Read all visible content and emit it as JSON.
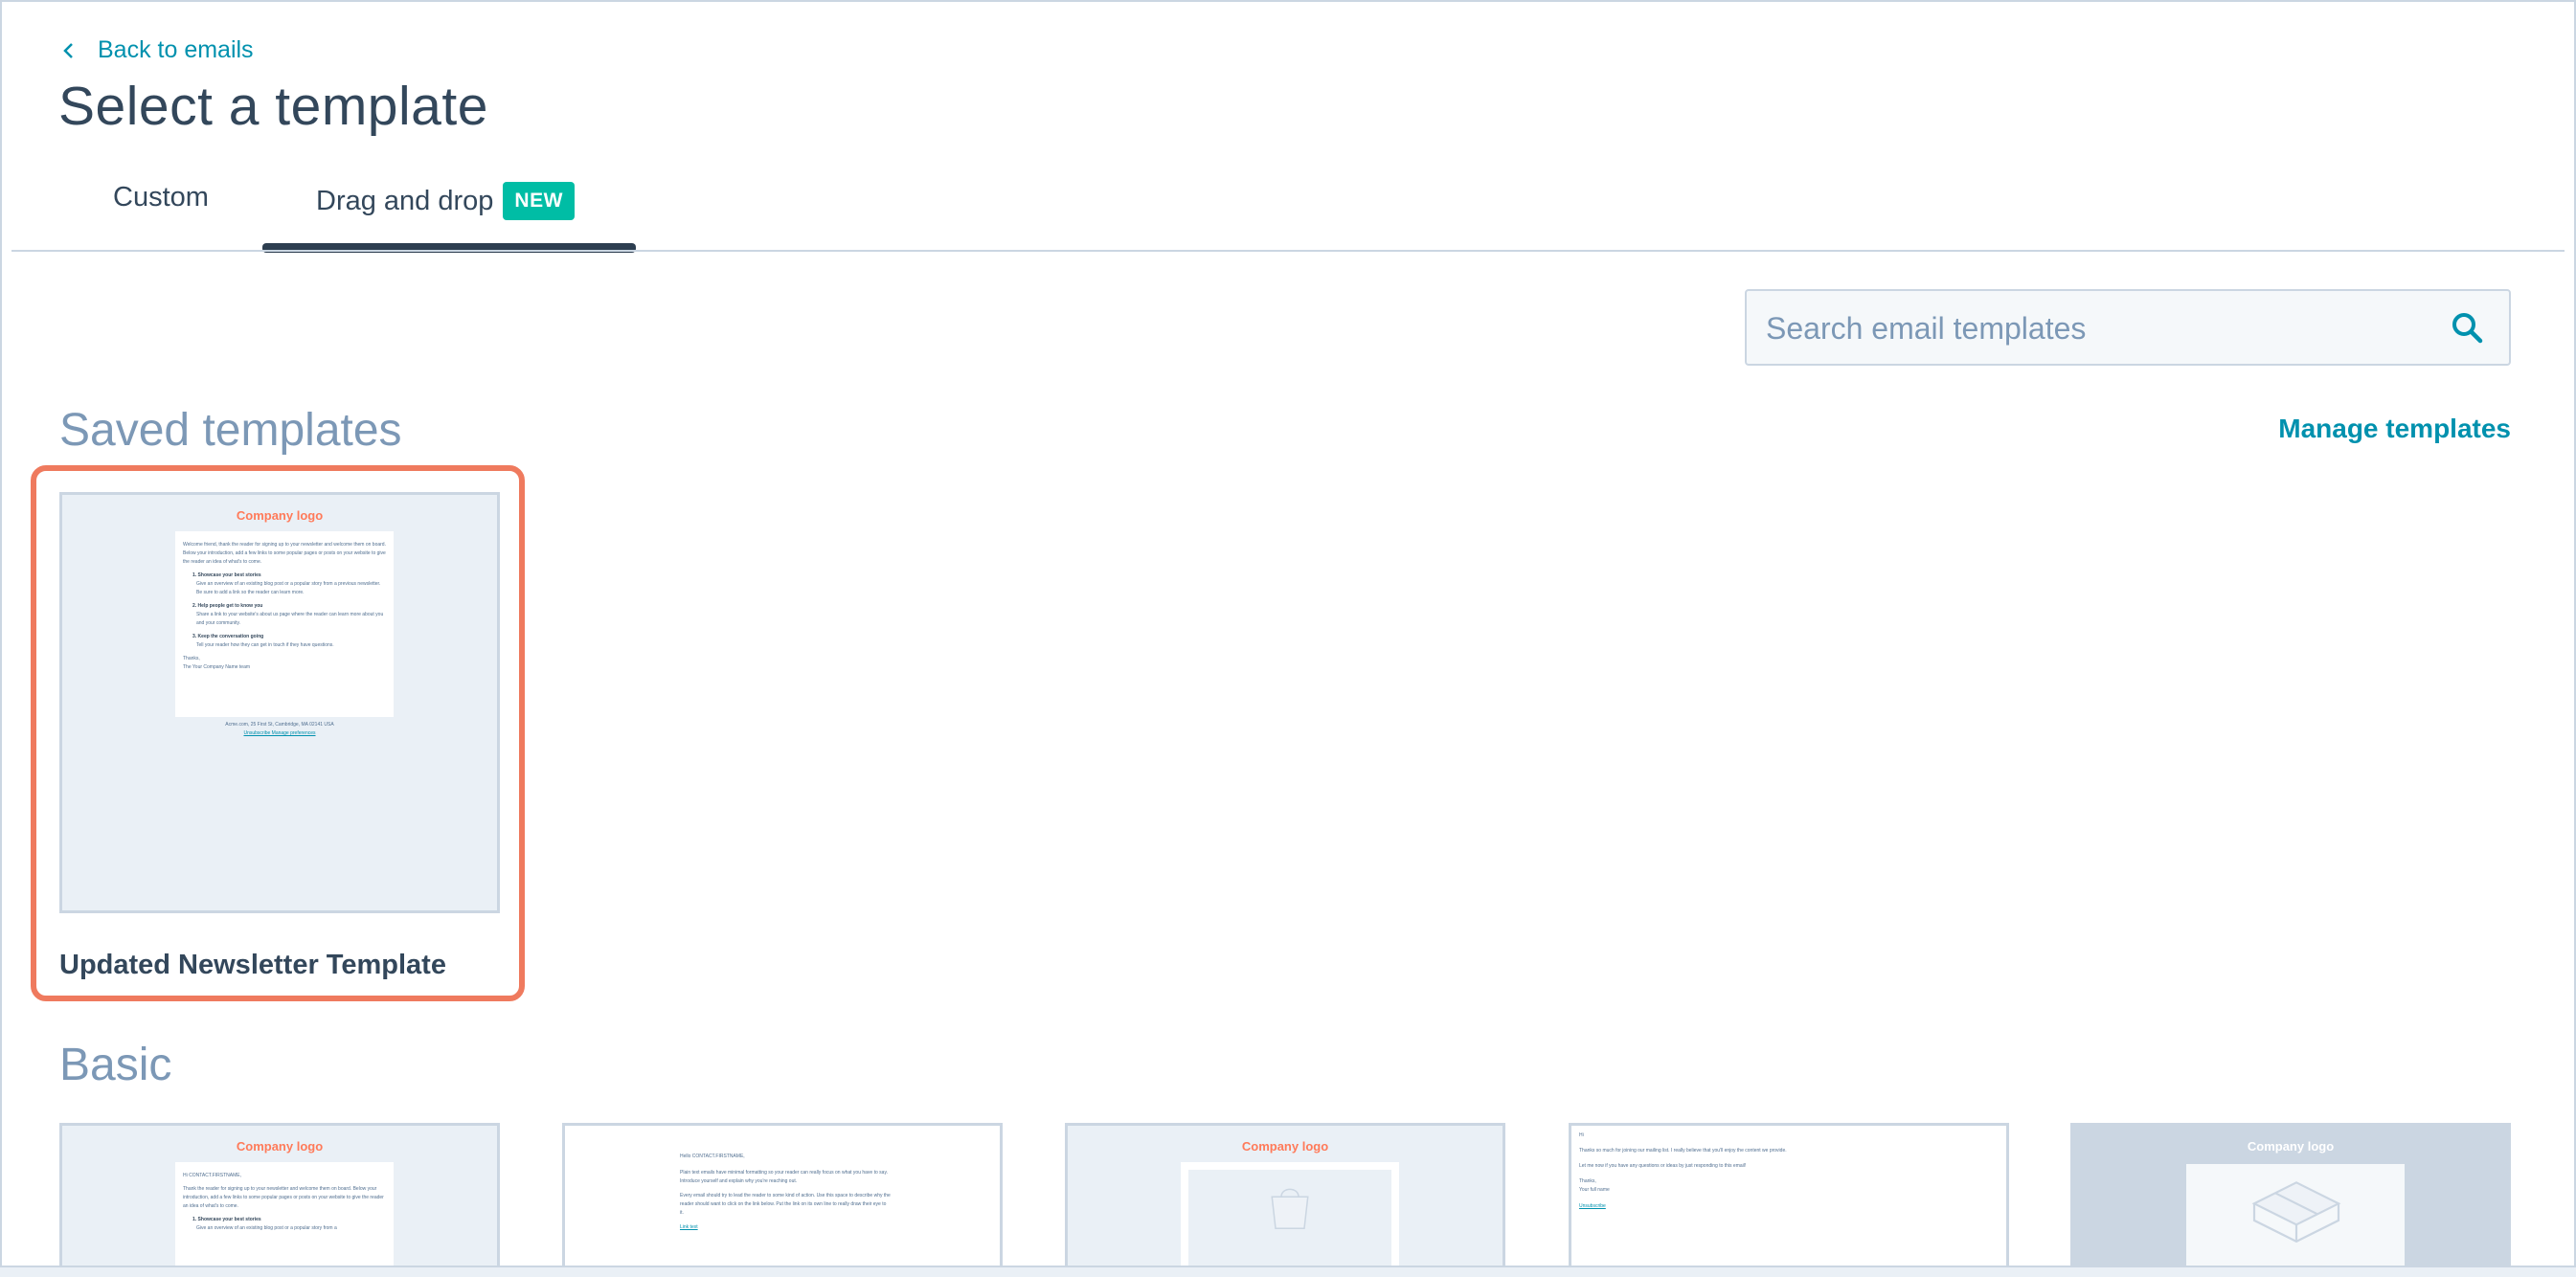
{
  "header": {
    "back_label": "Back to emails",
    "title": "Select a template"
  },
  "tabs": [
    {
      "label": "Custom"
    },
    {
      "label": "Drag and drop",
      "badge": "NEW"
    }
  ],
  "search": {
    "placeholder": "Search email templates"
  },
  "saved": {
    "title": "Saved templates",
    "manage_label": "Manage templates",
    "cards": [
      {
        "name": "Updated Newsletter Template",
        "logo": "Company logo",
        "intro": "Welcome friend, thank the reader for signing up to your newsletter and welcome them on board. Below your introduction, add a few links to some popular pages or posts on your website to give the reader an idea of what's to come.",
        "items": [
          {
            "heading": "1. Showcase your best stories",
            "text": "Give an overview of an existing blog post or a popular story from a previous newsletter. Be sure to add a link so the reader can learn more."
          },
          {
            "heading": "2. Help people get to know you",
            "text": "Share a link to your website's about us page where the reader can learn more about you and your community."
          },
          {
            "heading": "3. Keep the conversation going",
            "text": "Tell your reader how they can get in touch if they have questions."
          }
        ],
        "signoff": "Thanks,",
        "team": "The Your Company Name team",
        "footer_address": "Acme.com, 25 First St, Cambridge, MA 02141 USA",
        "footer_links": "Unsubscribe Manage preferences"
      }
    ]
  },
  "basic": {
    "title": "Basic",
    "cards": [
      {
        "logo": "Company logo",
        "greeting": "Hi CONTACT.FIRSTNAME,",
        "body": "Thank the reader for signing up to your newsletter and welcome them on board. Below your introduction, add a few links to some popular pages or posts on your website to give the reader an idea of what's to come.",
        "item": "1. Showcase your best stories",
        "item_text": "Give an overview of an existing blog post or a popular story from a"
      },
      {
        "greeting": "Hello CONTACT.FIRSTNAME,",
        "body": "Plain text emails have minimal formatting so your reader can really focus on what you have to say. Introduce yourself and explain why you're reaching out.",
        "body2": "Every email should try to lead the reader to some kind of action. Use this space to describe why the reader should want to click on the link below. Put the link on its own line to really draw their eye to it.",
        "link": "Link text"
      },
      {
        "logo": "Company logo"
      },
      {
        "greeting": "Hi",
        "body": "Thanks so much for joining our mailing list. I really believe that you'll enjoy the content we provide.",
        "body2": "Let me now if you have any questions or ideas by just responding to this email!",
        "signoff": "Thanks,",
        "name": "Your full name",
        "link": "Unsubscribe"
      },
      {
        "logo": "Company logo"
      }
    ]
  },
  "colors": {
    "accent": "#0091ae",
    "badge": "#00bda5",
    "highlight": "#ef7a5e",
    "logo": "#ff7a59",
    "heading": "#33475b",
    "section": "#7c98b6"
  }
}
